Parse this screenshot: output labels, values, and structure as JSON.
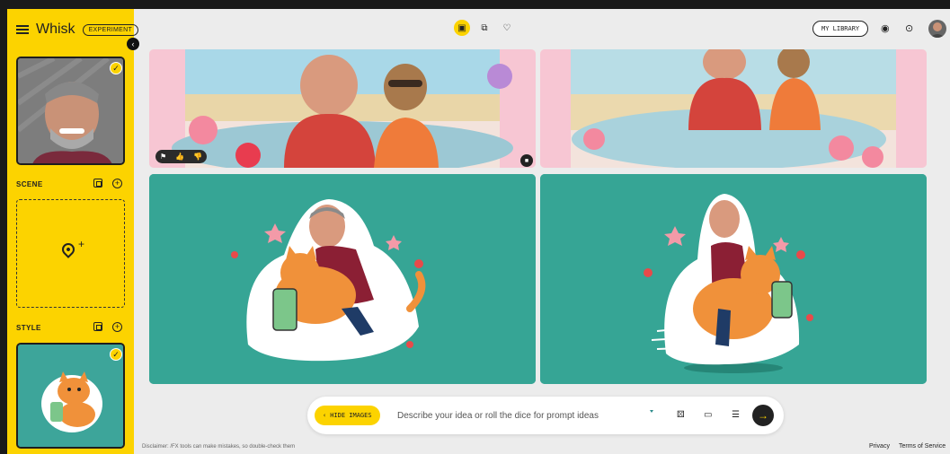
{
  "sidebar": {
    "brand": "Whisk",
    "badge": "EXPERIMENT",
    "scene_label": "SCENE",
    "style_label": "STYLE"
  },
  "header": {
    "library_button": "MY LIBRARY"
  },
  "prompt": {
    "hide_images_label": "HIDE IMAGES",
    "placeholder": "Describe your idea or roll the dice for prompt ideas"
  },
  "footer": {
    "disclaimer": "Disclaimer: /FX tools can make mistakes, so double-check them",
    "privacy": "Privacy",
    "terms": "Terms of Service"
  },
  "colors": {
    "accent": "#fcd300",
    "sticker_background": "#36a595"
  }
}
